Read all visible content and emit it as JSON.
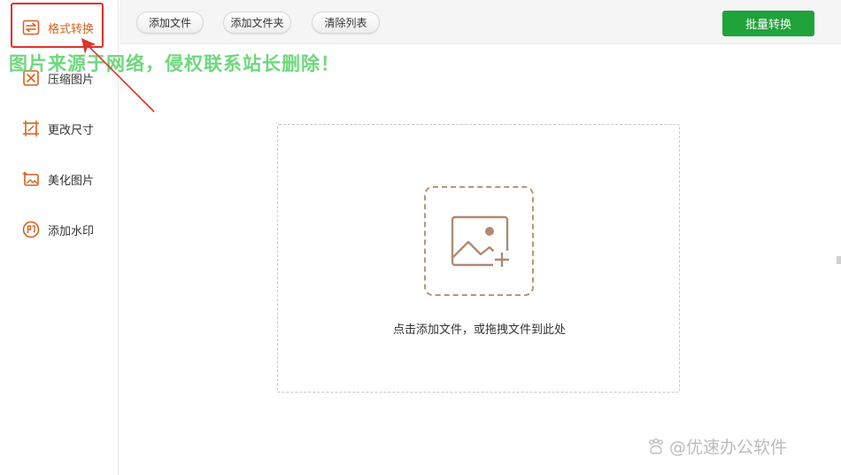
{
  "sidebar": {
    "items": [
      {
        "label": "格式转换",
        "icon": "format-convert-icon",
        "active": true
      },
      {
        "label": "压缩图片",
        "icon": "compress-icon",
        "active": false
      },
      {
        "label": "更改尺寸",
        "icon": "resize-icon",
        "active": false
      },
      {
        "label": "美化图片",
        "icon": "beautify-icon",
        "active": false
      },
      {
        "label": "添加水印",
        "icon": "watermark-stamp-icon",
        "active": false
      }
    ]
  },
  "toolbar": {
    "add_file": "添加文件",
    "add_folder": "添加文件夹",
    "clear_list": "清除列表",
    "batch_convert": "批量转换"
  },
  "overlay": {
    "notice": "图片来源于网络，侵权联系站长删除！",
    "brand": "@优速办公软件"
  },
  "dropzone": {
    "hint": "点击添加文件，或拖拽文件到此处"
  },
  "colors": {
    "accent": "#d9621e",
    "primary_button": "#1fa33a",
    "highlight": "#e0302b",
    "notice_text": "#5ed46e"
  }
}
